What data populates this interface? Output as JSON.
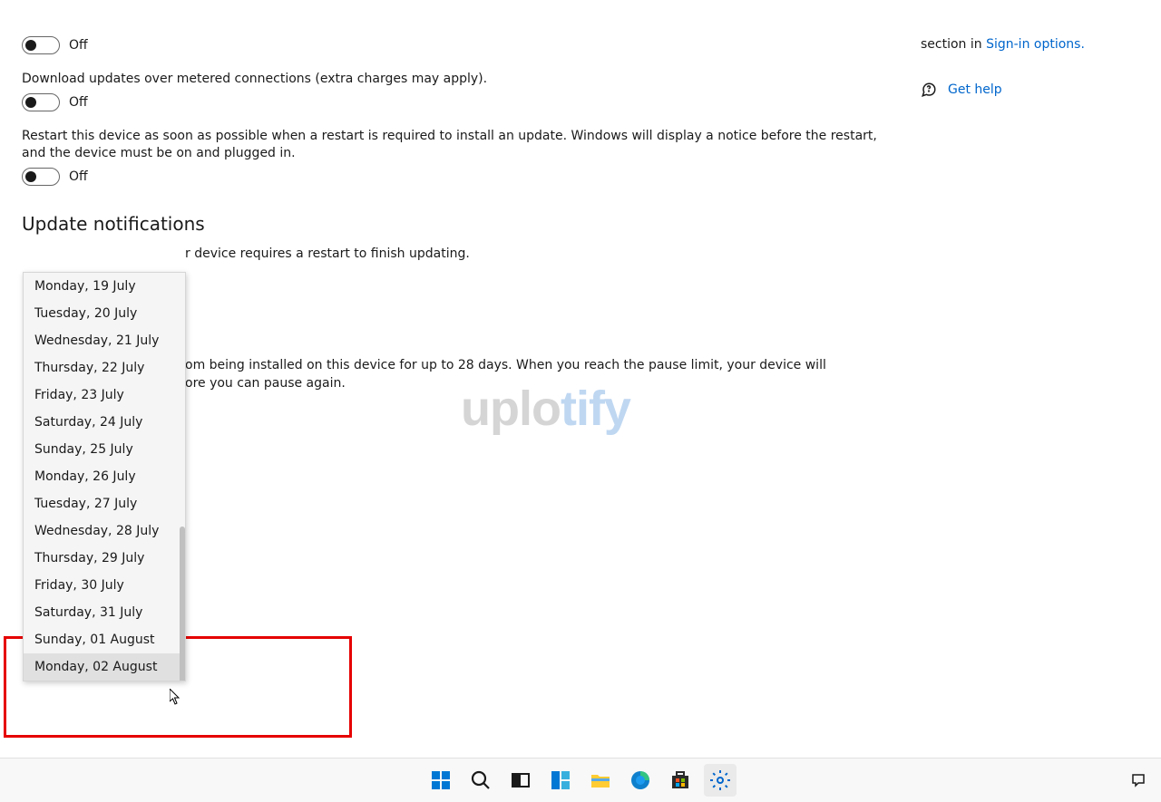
{
  "settings": {
    "toggle1": {
      "state": "Off"
    },
    "metered": {
      "desc": "Download updates over metered connections (extra charges may apply).",
      "state": "Off"
    },
    "restart": {
      "desc": "Restart this device as soon as possible when a restart is required to install an update. Windows will display a notice before the restart, and the device must be on and plugged in.",
      "state": "Off"
    }
  },
  "notifications": {
    "heading": "Update notifications",
    "partial_line": "r device requires a restart to finish updating."
  },
  "pause": {
    "partial_line1": "om being installed on this device for up to 28 days. When you reach the pause limit, your device will",
    "partial_line2": "ore you can pause again."
  },
  "dropdown": {
    "items": [
      "Monday, 19 July",
      "Tuesday, 20 July",
      "Wednesday, 21 July",
      "Thursday, 22 July",
      "Friday, 23 July",
      "Saturday, 24 July",
      "Sunday, 25 July",
      "Monday, 26 July",
      "Tuesday, 27 July",
      "Wednesday, 28 July",
      "Thursday, 29 July",
      "Friday, 30 July",
      "Saturday, 31 July",
      "Sunday, 01 August",
      "Monday, 02 August"
    ],
    "highlighted_index": 14
  },
  "sidepanel": {
    "text_prefix": "section in ",
    "link": "Sign-in options.",
    "get_help": "Get help"
  },
  "watermark": {
    "part1": "uplo",
    "part2": "tify"
  },
  "taskbar": {
    "icons": [
      "start",
      "search",
      "task-view",
      "widgets",
      "file-explorer",
      "edge",
      "store",
      "settings"
    ]
  }
}
